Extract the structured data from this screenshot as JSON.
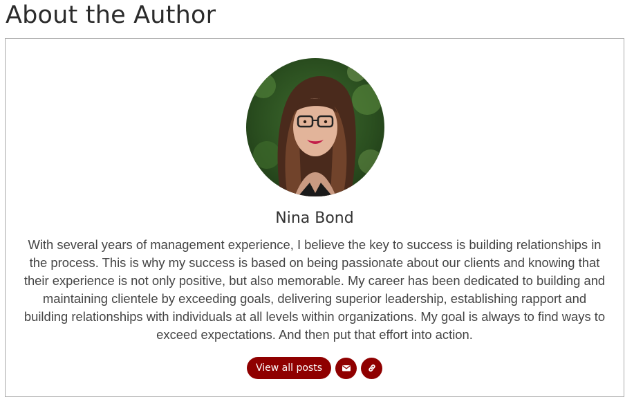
{
  "page": {
    "title": "About the Author"
  },
  "author": {
    "name": "Nina Bond",
    "bio": "With several years of management experience, I believe the key to success is building relationships in the process. This is why my success is based on being passionate about our clients and knowing that their experience is not only positive, but also memorable. My career has been dedicated to building and maintaining clientele by exceeding goals, delivering superior leadership, establishing rapport and building relationships with individuals at all levels within organizations. My goal is always to find ways to exceed expectations. And then put that effort into action.",
    "avatar_icon": "author-photo"
  },
  "actions": {
    "view_posts_label": "View all posts",
    "email_icon": "envelope-icon",
    "website_icon": "link-icon"
  },
  "colors": {
    "accent": "#8f0000",
    "border": "#a9a9a9",
    "text": "#333333"
  }
}
